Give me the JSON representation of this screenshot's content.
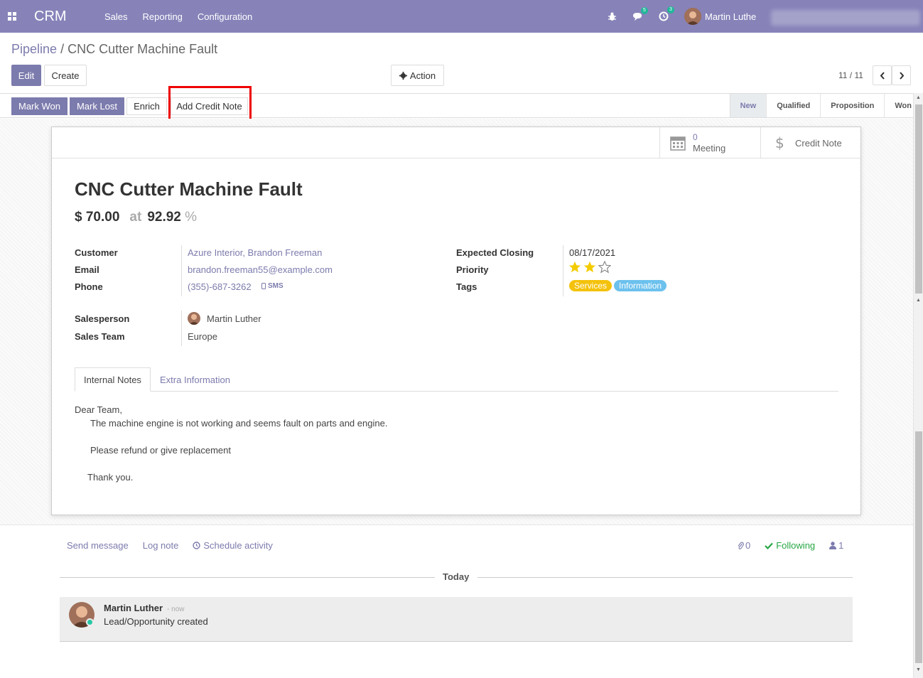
{
  "navbar": {
    "brand": "CRM",
    "menu": [
      "Sales",
      "Reporting",
      "Configuration"
    ],
    "messages_count": "5",
    "activities_count": "3",
    "user_name": "Martin Luthe"
  },
  "breadcrumb": {
    "parent": "Pipeline",
    "separator": "/",
    "current": "CNC Cutter Machine Fault"
  },
  "toolbar": {
    "edit": "Edit",
    "create": "Create",
    "action": "Action",
    "pager": "11 / 11"
  },
  "statusbar": {
    "buttons": [
      "Mark Won",
      "Mark Lost",
      "Enrich",
      "Add Credit Note"
    ],
    "stages": [
      "New",
      "Qualified",
      "Proposition",
      "Won"
    ],
    "active_stage": "New"
  },
  "smart_buttons": {
    "meeting_count": "0",
    "meeting_label": "Meeting",
    "credit_note_label": "Credit Note"
  },
  "record": {
    "title": "CNC Cutter Machine Fault",
    "revenue": "$ 70.00",
    "at": "at",
    "probability": "92.92",
    "pct": "%"
  },
  "fields": {
    "customer_label": "Customer",
    "customer": "Azure Interior, Brandon Freeman",
    "email_label": "Email",
    "email": "brandon.freeman55@example.com",
    "phone_label": "Phone",
    "phone": "(355)-687-3262",
    "sms": "SMS",
    "salesperson_label": "Salesperson",
    "salesperson": "Martin Luther",
    "sales_team_label": "Sales Team",
    "sales_team": "Europe",
    "expected_closing_label": "Expected Closing",
    "expected_closing": "08/17/2021",
    "priority_label": "Priority",
    "priority_stars": 2,
    "priority_max": 3,
    "tags_label": "Tags",
    "tags": [
      {
        "name": "Services",
        "color": "#f4c20d"
      },
      {
        "name": "Information",
        "color": "#6cc1ed"
      }
    ]
  },
  "tabs": {
    "internal_notes": "Internal Notes",
    "extra_information": "Extra Information"
  },
  "notes": {
    "line1": "Dear Team,",
    "line2": "The machine engine is  not working and seems fault on parts and engine.",
    "line3": "Please refund or give replacement",
    "line4": "Thank you."
  },
  "chatter": {
    "send_message": "Send message",
    "log_note": "Log note",
    "schedule_activity": "Schedule activity",
    "attachments": "0",
    "following": "Following",
    "followers": "1",
    "date_separator": "Today",
    "message": {
      "author": "Martin Luther",
      "time": "- now",
      "body": "Lead/Opportunity created"
    }
  },
  "colors": {
    "brand": "#8783b9",
    "link": "#7c7bad",
    "success": "#28a745"
  }
}
